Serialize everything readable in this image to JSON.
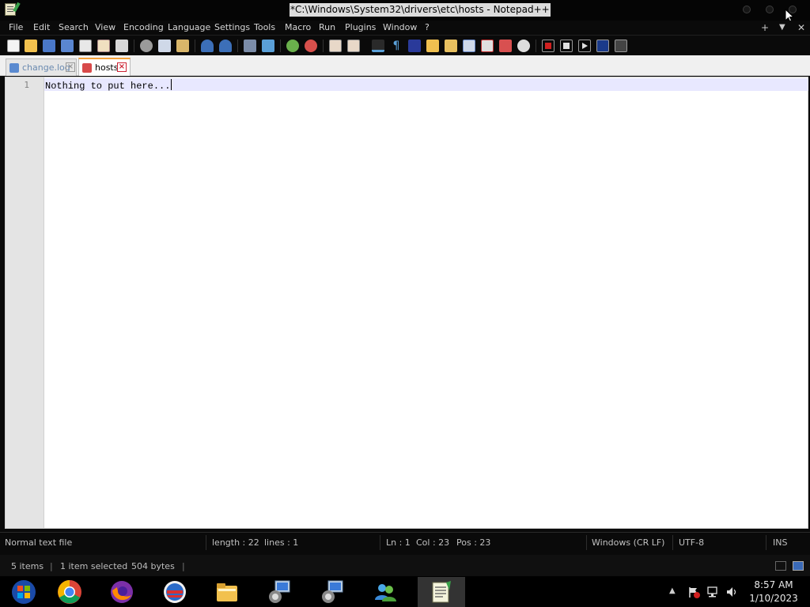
{
  "window": {
    "title": "*C:\\Windows\\System32\\drivers\\etc\\hosts - Notepad++"
  },
  "menu": {
    "items": [
      "File",
      "Edit",
      "Search",
      "View",
      "Encoding",
      "Language",
      "Settings",
      "Tools",
      "Macro",
      "Run",
      "Plugins",
      "Window",
      "?"
    ],
    "right_controls": [
      "+",
      "▼",
      "✕"
    ]
  },
  "tabs": [
    {
      "label": "change.log",
      "active": false
    },
    {
      "label": "hosts",
      "active": true
    }
  ],
  "editor": {
    "lines": [
      {
        "number": "1",
        "text": "Nothing to put here..."
      }
    ]
  },
  "status": {
    "file_type": "Normal text file",
    "length": "length : 22",
    "lines": "lines : 1",
    "ln": "Ln : 1",
    "col": "Col : 23",
    "pos": "Pos : 23",
    "eol": "Windows (CR LF)",
    "encoding": "UTF-8",
    "mode": "INS"
  },
  "explorer_status": {
    "items_count": "5 items",
    "selection": "1 item selected",
    "size": "504 bytes"
  },
  "taskbar": {
    "apps": [
      "Windows",
      "Chrome",
      "Firefox",
      "Outlook",
      "File Explorer",
      "Network Tool",
      "Network Tool 2",
      "Users",
      "Notepad++"
    ],
    "time": "8:57 AM",
    "date": "1/10/2023"
  },
  "colors": {
    "accent_tab": "#f4a13a",
    "current_line": "#e8e8ff",
    "title_bg": "#dcdcdc"
  }
}
